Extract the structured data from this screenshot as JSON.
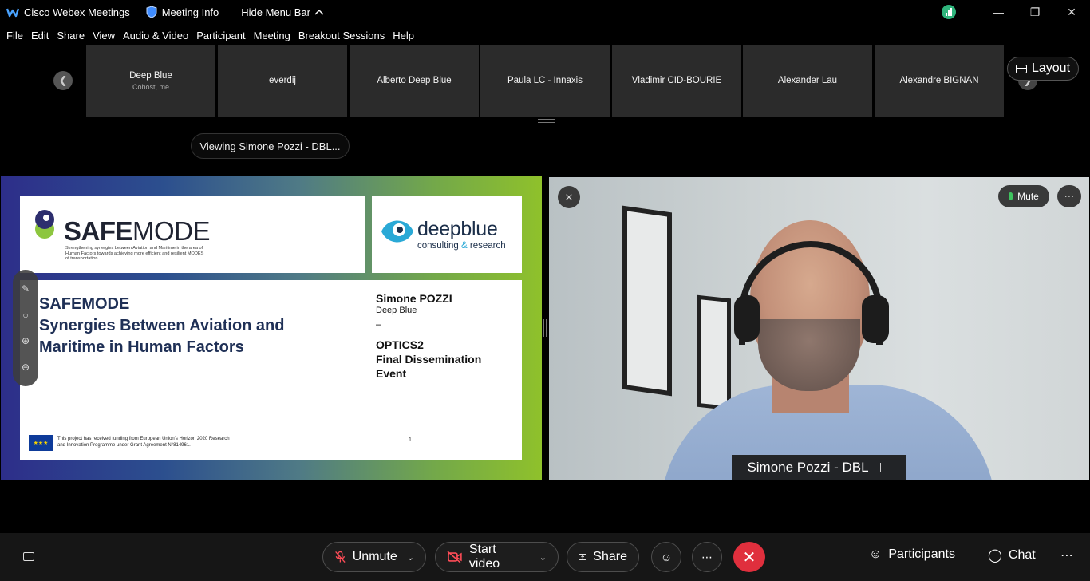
{
  "titlebar": {
    "app_name": "Cisco Webex Meetings",
    "meeting_info": "Meeting Info",
    "hide_menu": "Hide Menu Bar"
  },
  "menu": [
    "File",
    "Edit",
    "Share",
    "View",
    "Audio & Video",
    "Participant",
    "Meeting",
    "Breakout Sessions",
    "Help"
  ],
  "participants": [
    {
      "name": "Deep Blue",
      "sub": "Cohost, me"
    },
    {
      "name": "everdij",
      "sub": ""
    },
    {
      "name": "Alberto Deep Blue",
      "sub": ""
    },
    {
      "name": "Paula LC - Innaxis",
      "sub": ""
    },
    {
      "name": "Vladimir CID-BOURIE",
      "sub": ""
    },
    {
      "name": "Alexander Lau",
      "sub": ""
    },
    {
      "name": "Alexandre BIGNAN",
      "sub": ""
    }
  ],
  "layout_label": "Layout",
  "viewing_label": "Viewing Simone Pozzi - DBL...",
  "slide": {
    "logo_safe": "SAFE",
    "logo_mode": "MODE",
    "tagline": "Strengthening synergies between Aviation and Maritime in the area of Human Factors towards achieving more efficient and resilient MODES of transportation.",
    "db_word": "deepblue",
    "db_sub_1": "consulting",
    "db_amp": "&",
    "db_sub_2": "research",
    "title_1": "SAFEMODE",
    "title_2": "Synergies Between Aviation and",
    "title_3": "Maritime in Human Factors",
    "speaker_name": "Simone POZZI",
    "speaker_org": "Deep Blue",
    "dash": "–",
    "event_1": "OPTICS2",
    "event_2": "Final Dissemination",
    "event_3": "Event",
    "funding": "This project has received funding from European Union's Horizon 2020 Research and Innovation Programme under Grant Agreement N°814961.",
    "page": "1"
  },
  "video": {
    "mute_label": "Mute",
    "name_tag": "Simone Pozzi - DBL"
  },
  "controls": {
    "unmute": "Unmute",
    "start_video": "Start video",
    "share": "Share",
    "participants": "Participants",
    "chat": "Chat"
  }
}
